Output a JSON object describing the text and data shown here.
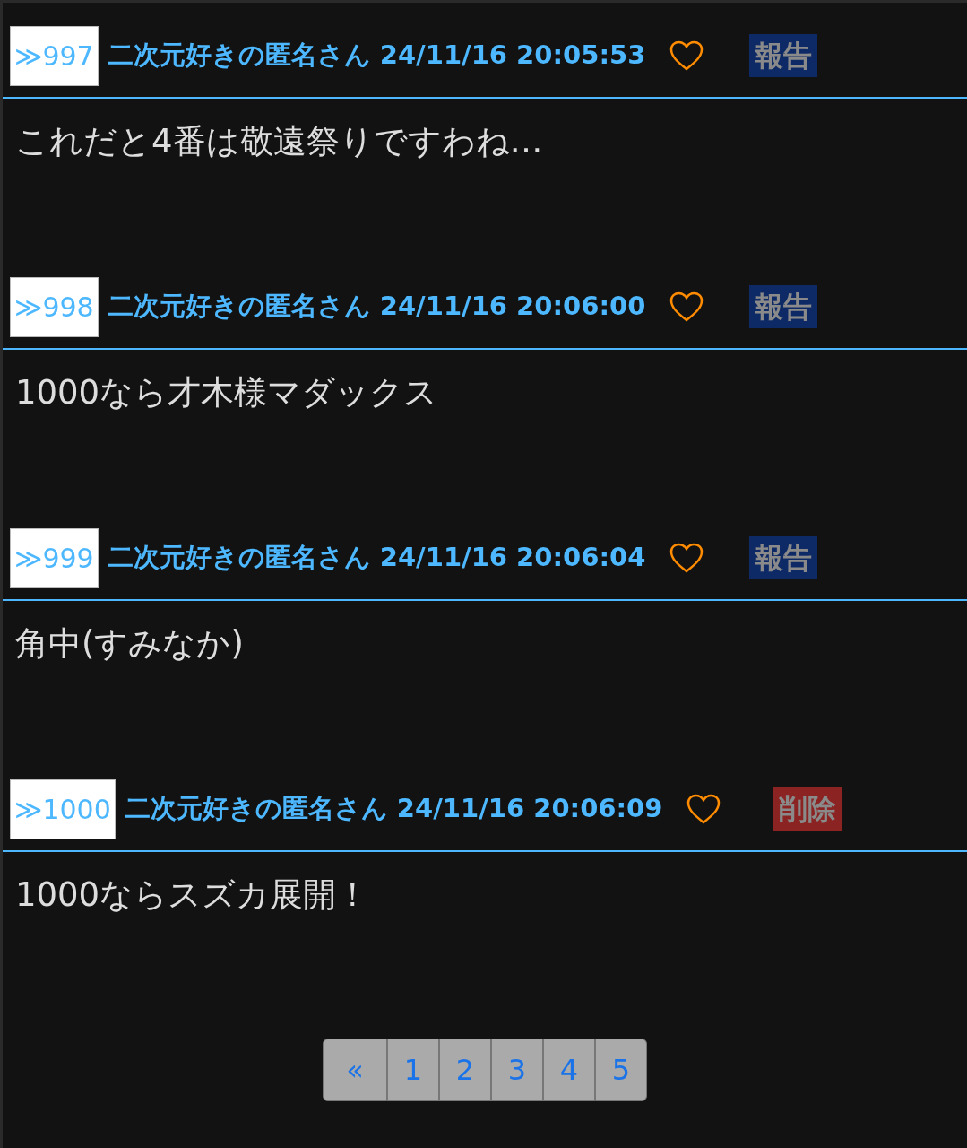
{
  "posts": [
    {
      "number": "≫997",
      "author": "二次元好きの匿名さん",
      "date": "24/11/16 20:05:53",
      "action": {
        "kind": "report",
        "label": "報告"
      },
      "body": "これだと4番は敬遠祭りですわね…"
    },
    {
      "number": "≫998",
      "author": "二次元好きの匿名さん",
      "date": "24/11/16 20:06:00",
      "action": {
        "kind": "report",
        "label": "報告"
      },
      "body": "1000なら才木様マダックス"
    },
    {
      "number": "≫999",
      "author": "二次元好きの匿名さん",
      "date": "24/11/16 20:06:04",
      "action": {
        "kind": "report",
        "label": "報告"
      },
      "body": "角中(すみなか)"
    },
    {
      "number": "≫1000",
      "author": "二次元好きの匿名さん",
      "date": "24/11/16 20:06:09",
      "action": {
        "kind": "delete",
        "label": "削除"
      },
      "body": "1000ならスズカ展開！"
    }
  ],
  "pagination": {
    "previous": "«",
    "pages": [
      "1",
      "2",
      "3",
      "4",
      "5"
    ]
  }
}
